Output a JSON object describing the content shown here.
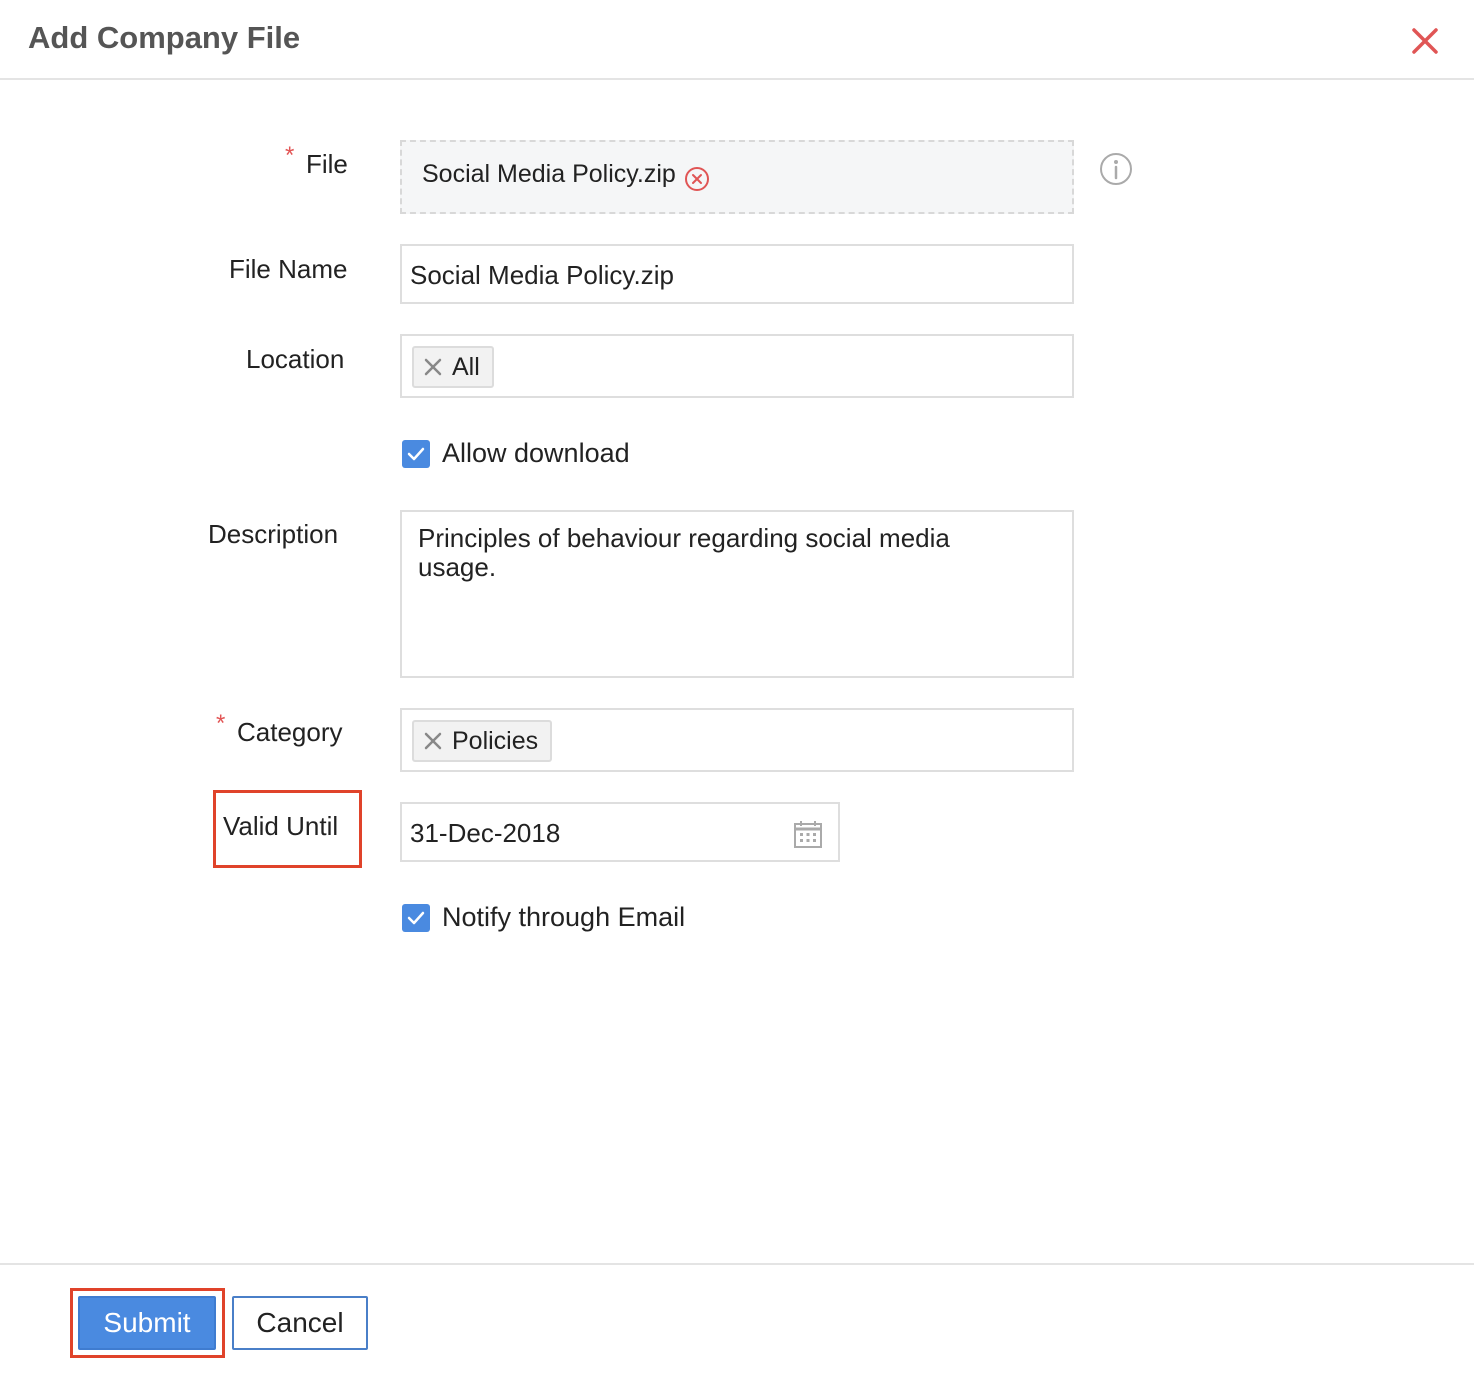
{
  "dialog": {
    "title": "Add Company File"
  },
  "form": {
    "file": {
      "label": "File",
      "value": "Social Media Policy.zip",
      "required": true
    },
    "file_name": {
      "label": "File Name",
      "value": "Social Media Policy.zip"
    },
    "location": {
      "label": "Location",
      "tags": [
        "All"
      ]
    },
    "allow_download": {
      "label": "Allow download",
      "checked": true
    },
    "description": {
      "label": "Description",
      "value": "Principles of behaviour regarding social media usage."
    },
    "category": {
      "label": "Category",
      "tags": [
        "Policies"
      ],
      "required": true
    },
    "valid_until": {
      "label": "Valid Until",
      "value": "31-Dec-2018"
    },
    "notify_email": {
      "label": "Notify through Email",
      "checked": true
    }
  },
  "footer": {
    "submit_label": "Submit",
    "cancel_label": "Cancel"
  },
  "colors": {
    "accent": "#4a8ae0",
    "required": "#e25555",
    "highlight": "#e0432a"
  },
  "icons": {
    "close": "close-icon",
    "info": "info-icon",
    "remove_file": "remove-circle-icon",
    "tag_remove": "x-icon",
    "calendar": "calendar-icon",
    "check": "checkmark-icon"
  }
}
